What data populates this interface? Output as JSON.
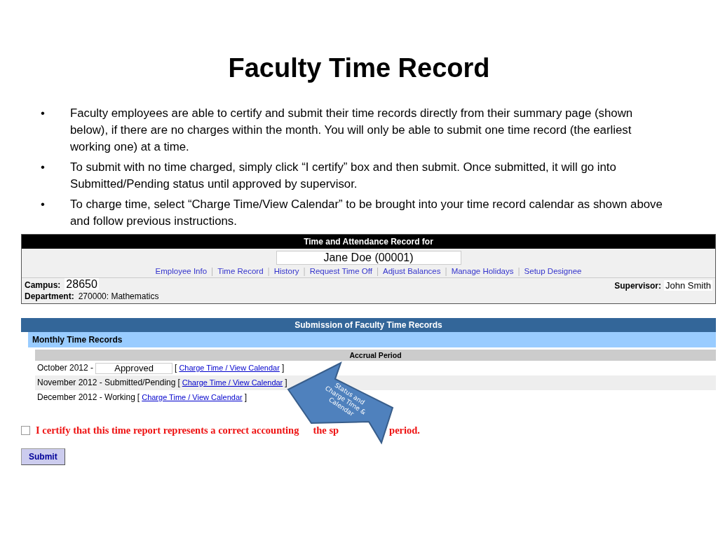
{
  "slide": {
    "title": "Faculty Time Record",
    "bullets": [
      {
        "marker": "•",
        "text": "Faculty employees are able to certify and submit their time records directly from their summary page (shown below), if there are no charges within the month. You will only be able to submit one time record (the earliest working one) at a time."
      },
      {
        "marker": "•",
        "text": "To submit with no time charged, simply click “I certify” box and then submit.  Once submitted, it will go into Submitted/Pending status until approved by supervisor."
      },
      {
        "marker": "•",
        "text": "To charge time, select “Charge Time/View Calendar” to be brought into your time record calendar as shown above and follow previous instructions."
      }
    ]
  },
  "header": {
    "title": "Time and Attendance Record for",
    "employee": "Jane Doe (00001)",
    "nav_links": [
      "Employee Info",
      "Time Record",
      "History",
      "Request Time Off",
      "Adjust Balances",
      "Manage Holidays",
      "Setup Designee"
    ],
    "nav_separator": "|",
    "campus_label": "Campus:",
    "campus": "28650",
    "department_label": "Department:",
    "department": "270000: Mathematics",
    "supervisor_label": "Supervisor:",
    "supervisor": "John Smith"
  },
  "submission": {
    "title": "Submission of Faculty Time Records",
    "section": "Monthly Time Records",
    "column_header": "Accrual Period",
    "records": [
      {
        "period": "October 2012 -",
        "status": "Approved",
        "kind": "boxed",
        "open": "[",
        "link": "Charge Time / View Calendar",
        "close": "]"
      },
      {
        "period": "November 2012 - Submitted/Pending",
        "kind": "plain",
        "open": "[",
        "link": "Charge Time / View Calendar",
        "close": "]"
      },
      {
        "period": "December 2012 - Working",
        "kind": "plain",
        "open": "[",
        "link": "Charge Time / View Calendar",
        "close": "]"
      }
    ]
  },
  "certify": {
    "checked": false,
    "text_parts": [
      "I certify that this time report represents a correct accounting",
      "the sp",
      "period."
    ]
  },
  "submit": "Submit",
  "callout": {
    "lines": [
      "Status and",
      "Charge Time &",
      "Calendar"
    ]
  }
}
